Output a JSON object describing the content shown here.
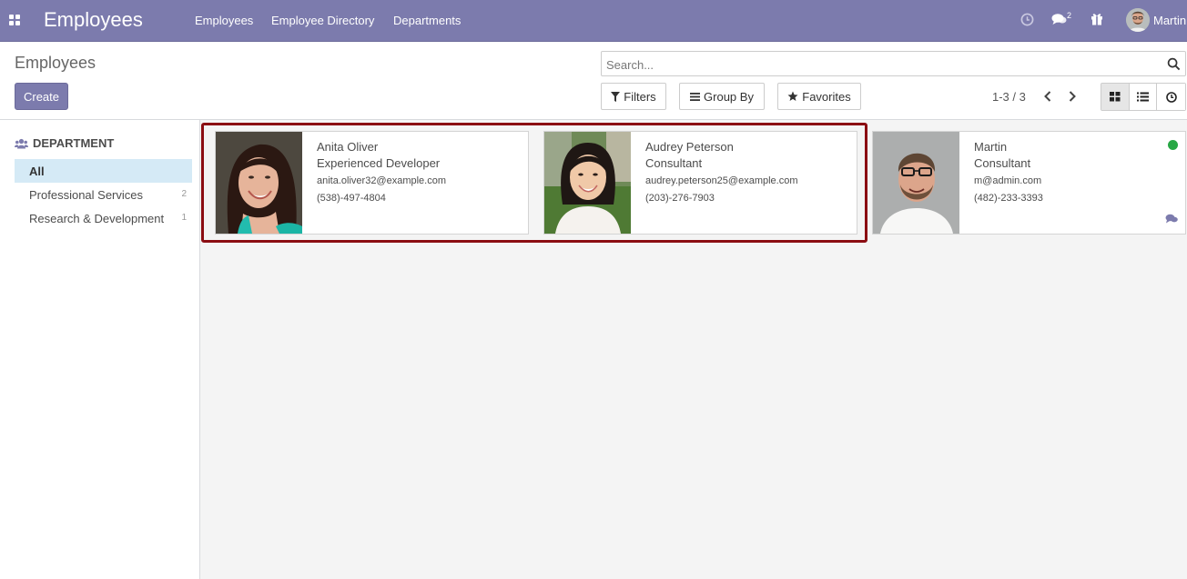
{
  "navbar": {
    "app_title": "Employees",
    "menu": [
      "Employees",
      "Employee Directory",
      "Departments"
    ],
    "chat_badge": "2",
    "user_name": "Martin"
  },
  "control_panel": {
    "breadcrumb": "Employees",
    "create_label": "Create",
    "search_placeholder": "Search...",
    "filters_label": "Filters",
    "groupby_label": "Group By",
    "favorites_label": "Favorites",
    "pager": "1-3 / 3"
  },
  "sidebar": {
    "header": "DEPARTMENT",
    "items": [
      {
        "label": "All",
        "count": ""
      },
      {
        "label": "Professional Services",
        "count": "2"
      },
      {
        "label": "Research & Development",
        "count": "1"
      }
    ]
  },
  "employees": [
    {
      "name": "Anita Oliver",
      "job": "Experienced Developer",
      "email": "anita.oliver32@example.com",
      "phone": "(538)-497-4804"
    },
    {
      "name": "Audrey Peterson",
      "job": "Consultant",
      "email": "audrey.peterson25@example.com",
      "phone": "(203)-276-7903"
    },
    {
      "name": "Martin",
      "job": "Consultant",
      "email": "m@admin.com",
      "phone": "(482)-233-3393"
    }
  ],
  "colors": {
    "brand": "#7c7bad",
    "highlight": "#8b0d12",
    "online": "#28a745",
    "active_filter": "#d5eaf6"
  }
}
